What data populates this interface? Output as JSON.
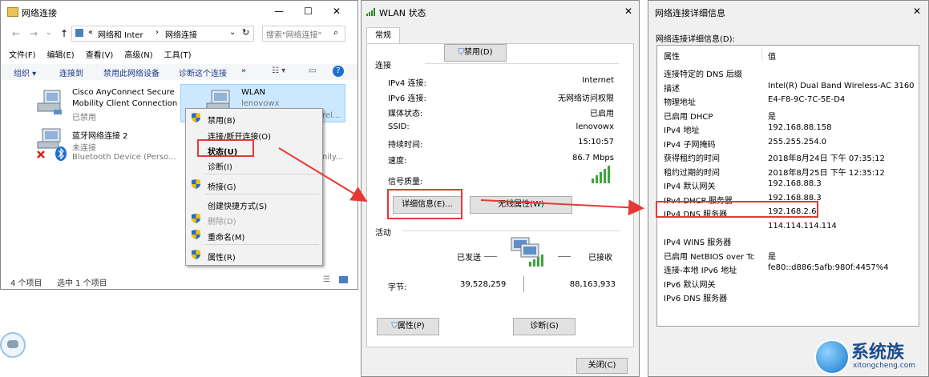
{
  "explorer": {
    "title": "网络连接",
    "nav": {
      "back": "←",
      "forward": "→",
      "up": "↑",
      "sep": "«",
      "crumb1": "网络和 Inter",
      "crumb_sep": "›",
      "crumb2": "网络连接",
      "refresh": "↻"
    },
    "search_placeholder": "搜索\"网络连接\"",
    "menu": [
      "文件(F)",
      "编辑(E)",
      "查看(V)",
      "高级(N)",
      "工具(T)"
    ],
    "toolbar": [
      "组织 ▾",
      "连接到",
      "禁用此网络设备",
      "诊断这个连接",
      "»"
    ],
    "items": {
      "cisco": {
        "name1": "Cisco AnyConnect Secure",
        "name2": "Mobility Client Connection",
        "status": "已禁用"
      },
      "wlan": {
        "name": "WLAN",
        "sub": "lenovowx",
        "adapter_tail": "rel..."
      },
      "bt": {
        "name": "蓝牙网络连接 2",
        "status": "未连接",
        "device": "Bluetooth Device (Perso...",
        "tail": "nily..."
      }
    },
    "statusbar": {
      "count": "4 个项目",
      "selected": "选中 1 个项目"
    }
  },
  "context_menu": {
    "items": [
      "禁用(B)",
      "连接/断开连接(O)",
      "状态(U)",
      "诊断(I)",
      "桥接(G)",
      "创建快捷方式(S)",
      "删除(D)",
      "重命名(M)",
      "属性(R)"
    ]
  },
  "status": {
    "title": "WLAN 状态",
    "tab": "常规",
    "connection_group": "连接",
    "rows": [
      {
        "label": "IPv4 连接:",
        "value": "Internet"
      },
      {
        "label": "IPv6 连接:",
        "value": "无网络访问权限"
      },
      {
        "label": "媒体状态:",
        "value": "已启用"
      },
      {
        "label": "SSID:",
        "value": "lenovowx"
      },
      {
        "label": "持续时间:",
        "value": "15:10:57"
      },
      {
        "label": "速度:",
        "value": "86.7 Mbps"
      }
    ],
    "signal_label": "信号质量:",
    "details_btn": "详细信息(E)...",
    "wireless_props_btn": "无线属性(W)",
    "activity_group": "活动",
    "sent": "已发送",
    "received": "已接收",
    "bytes_label": "字节:",
    "bytes_sent": "39,528,259",
    "bytes_received": "88,163,933",
    "props_btn": "属性(P)",
    "disable_btn": "禁用(D)",
    "diagnose_btn": "诊断(G)",
    "close_btn": "关闭(C)"
  },
  "details": {
    "title": "网络连接详细信息",
    "caption": "网络连接详细信息(D):",
    "col_prop": "属性",
    "col_val": "值",
    "rows": [
      {
        "p": "连接特定的 DNS 后缀",
        "v": ""
      },
      {
        "p": "描述",
        "v": "Intel(R) Dual Band Wireless-AC 3160"
      },
      {
        "p": "物理地址",
        "v": "E4-F8-9C-7C-5E-D4"
      },
      {
        "p": "已启用 DHCP",
        "v": "是"
      },
      {
        "p": "IPv4 地址",
        "v": "192.168.88.158"
      },
      {
        "p": "IPv4 子网掩码",
        "v": "255.255.254.0"
      },
      {
        "p": "获得租约的时间",
        "v": "2018年8月24日 下午 07:35:12"
      },
      {
        "p": "租约过期的时间",
        "v": "2018年8月25日 下午 12:35:12"
      },
      {
        "p": "IPv4 默认网关",
        "v": "192.168.88.3"
      },
      {
        "p": "IPv4 DHCP 服务器",
        "v": "192.168.88.3"
      },
      {
        "p": "IPv4 DNS 服务器",
        "v": "192.168.2.6"
      },
      {
        "p": "",
        "v": "114.114.114.114"
      },
      {
        "p": "IPv4 WINS 服务器",
        "v": ""
      },
      {
        "p": "已启用 NetBIOS over Tc",
        "v": "是"
      },
      {
        "p": "连接-本地 IPv6 地址",
        "v": "fe80::d886:5afb:980f:4457%4"
      },
      {
        "p": "IPv6 默认网关",
        "v": ""
      },
      {
        "p": "IPv6 DNS 服务器",
        "v": ""
      }
    ]
  },
  "watermark": {
    "brand": "系统族",
    "url": "xitongcheng.com"
  },
  "colors": {
    "highlight_red": "#e53935",
    "selection_blue": "#cce8ff",
    "link_blue": "#1a3a8a"
  }
}
